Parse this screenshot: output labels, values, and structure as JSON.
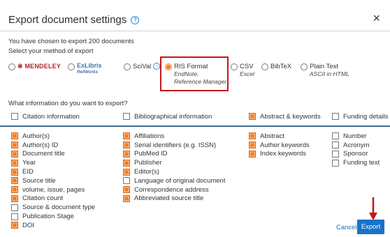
{
  "dialog": {
    "title": "Export document settings",
    "close_glyph": "×",
    "summary": "You have chosen to export 200 documents",
    "method_prompt": "Select your method of export"
  },
  "methods": [
    {
      "label": "MENDELEY",
      "selected": false
    },
    {
      "label": "ExLibris",
      "sublabel": "RefWorks",
      "selected": false
    },
    {
      "label": "SciVal",
      "selected": false
    },
    {
      "label": "RIS Format",
      "sublabel1": "EndNote,",
      "sublabel2": "Reference Manager",
      "selected": true
    },
    {
      "label": "CSV",
      "sublabel": "Excel",
      "selected": false
    },
    {
      "label": "BibTeX",
      "selected": false
    },
    {
      "label": "Plain Text",
      "sublabel": "ASCII in HTML",
      "selected": false
    }
  ],
  "info_prompt": "What information do you want to export?",
  "categories": [
    {
      "label": "Citation information",
      "checked": false
    },
    {
      "label": "Bibliographical information",
      "checked": false
    },
    {
      "label": "Abstract & keywords",
      "checked": true
    },
    {
      "label": "Funding details",
      "checked": false
    }
  ],
  "columns": {
    "citation": [
      {
        "label": "Author(s)",
        "checked": true
      },
      {
        "label": "Author(s) ID",
        "checked": true
      },
      {
        "label": "Document title",
        "checked": true
      },
      {
        "label": "Year",
        "checked": true
      },
      {
        "label": "EID",
        "checked": true
      },
      {
        "label": "Source title",
        "checked": true
      },
      {
        "label": "volume, issue, pages",
        "checked": true
      },
      {
        "label": "Citation count",
        "checked": true
      },
      {
        "label": "Source & document type",
        "checked": false
      },
      {
        "label": "Publication Stage",
        "checked": false
      },
      {
        "label": "DOI",
        "checked": true
      }
    ],
    "bibliographical": [
      {
        "label": "Affiliations",
        "checked": true
      },
      {
        "label": "Serial identifiers (e.g. ISSN)",
        "checked": true
      },
      {
        "label": "PubMed ID",
        "checked": true
      },
      {
        "label": "Publisher",
        "checked": true
      },
      {
        "label": "Editor(s)",
        "checked": true
      },
      {
        "label": "Language of original document",
        "checked": false
      },
      {
        "label": "Correspondence address",
        "checked": true
      },
      {
        "label": "Abbreviated source title",
        "checked": true
      }
    ],
    "abstract": [
      {
        "label": "Abstract",
        "checked": true
      },
      {
        "label": "Author keywords",
        "checked": true
      },
      {
        "label": "Index keywords",
        "checked": true
      }
    ],
    "funding": [
      {
        "label": "Number",
        "checked": false
      },
      {
        "label": "Acronym",
        "checked": false
      },
      {
        "label": "Sponsor",
        "checked": false
      },
      {
        "label": "Funding text",
        "checked": false
      }
    ]
  },
  "actions": {
    "cancel": "Cancel",
    "export": "Export"
  },
  "colors": {
    "accent": "#f47b20",
    "primary": "#1a73c8",
    "highlight": "#c4161c"
  }
}
